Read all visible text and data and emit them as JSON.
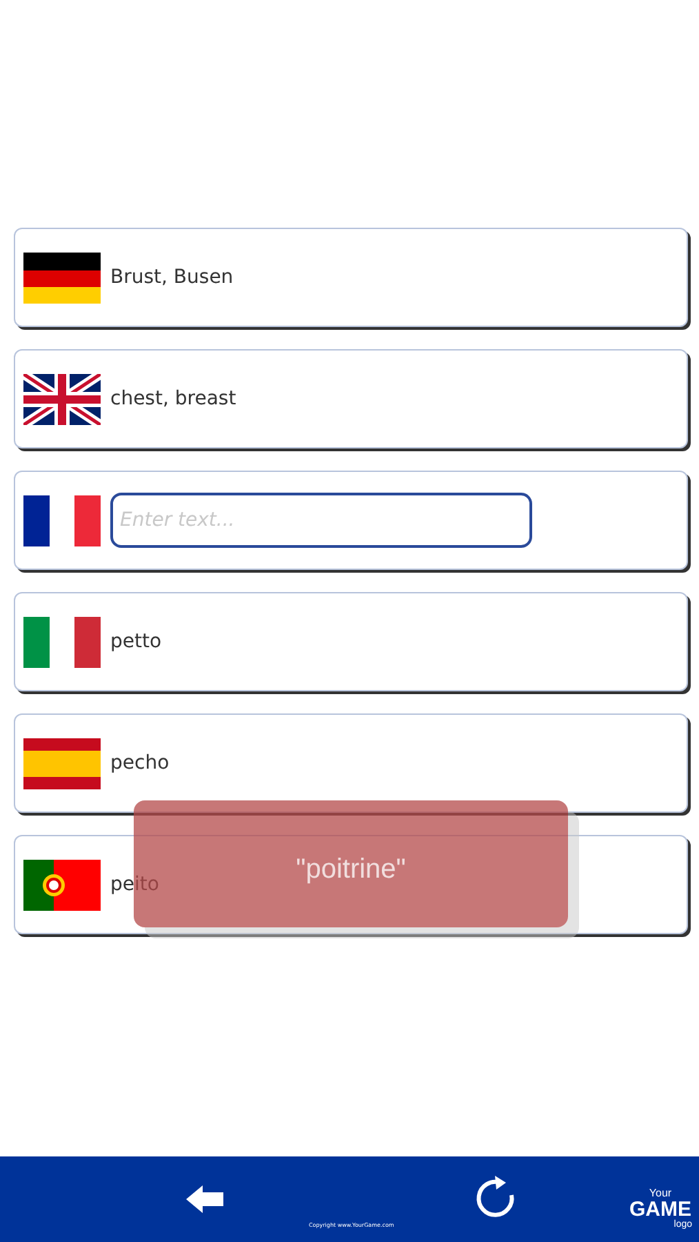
{
  "rows": [
    {
      "flag": {
        "kind": "de"
      },
      "kind": "text",
      "text": "Brust, Busen"
    },
    {
      "flag": {
        "kind": "gb"
      },
      "kind": "text",
      "text": "chest, breast"
    },
    {
      "flag": {
        "kind": "fr"
      },
      "kind": "input",
      "placeholder": "Enter text..."
    },
    {
      "flag": {
        "kind": "it"
      },
      "kind": "text",
      "text": "petto"
    },
    {
      "flag": {
        "kind": "es"
      },
      "kind": "text",
      "text": "pecho"
    },
    {
      "flag": {
        "kind": "pt"
      },
      "kind": "text",
      "text": "peito"
    }
  ],
  "toast": {
    "text": "\"poitrine\""
  },
  "bottom_bar": {
    "copyright": "Copyright www.YourGame.com",
    "logo": {
      "top": "Your",
      "main": "GAME",
      "bottom": "logo"
    }
  }
}
